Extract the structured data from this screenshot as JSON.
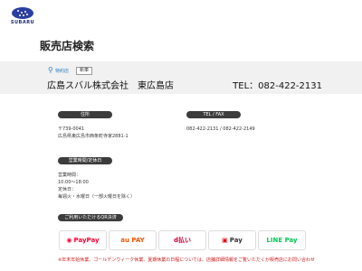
{
  "brand": {
    "logo_text": "SUBARU"
  },
  "page": {
    "title": "販売店検索"
  },
  "store": {
    "area": "特約店",
    "badge": "新車",
    "name": "広島スバル株式会社　東広島店",
    "tel": "TEL：082-422-2131"
  },
  "sections": {
    "address_label": "住所",
    "telfax_label": "TEL / FAX",
    "postal": "〒739-0041",
    "address": "広島県東広島市西条町寺家2881-1",
    "telfax": "082-422-2131 / 082-422-2149",
    "hours_label": "営業時間/定休日",
    "hours_lines": [
      "営業時間：",
      "10:00～18:00",
      "定休日：",
      "毎週火・水曜日（一部火曜日を除く）"
    ],
    "payment_label": "ご利用いただけるQR決済"
  },
  "payments": [
    {
      "name": "PayPay",
      "color": "#ff0033"
    },
    {
      "name": "au PAY",
      "color": "#eb5505"
    },
    {
      "name": "d払い",
      "color": "#cc0033"
    },
    {
      "name": "Pay",
      "color": "#e60012"
    },
    {
      "name": "LINE Pay",
      "color": "#06c755"
    }
  ],
  "note": "※年末年始休業、ゴールデンウィーク休業、夏期休業の日程については、店舗詳細情報をご覧いただくか販売店にお問い合わせ"
}
